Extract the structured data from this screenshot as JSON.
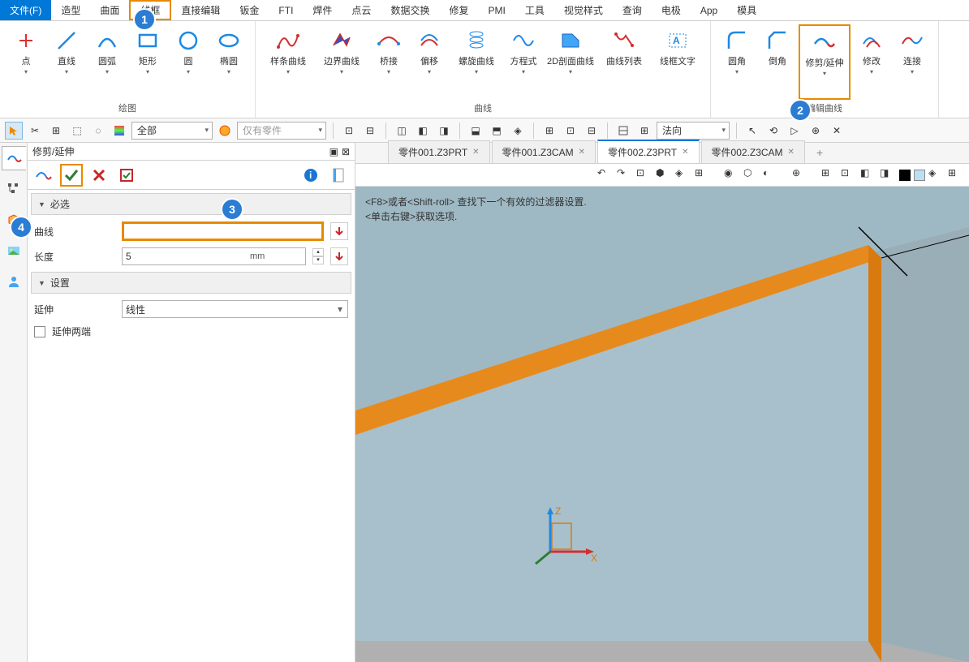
{
  "menu": {
    "file": "文件(F)",
    "items": [
      "造型",
      "曲面",
      "线框",
      "直接编辑",
      "钣金",
      "FTI",
      "焊件",
      "点云",
      "数据交换",
      "修复",
      "PMI",
      "工具",
      "视觉样式",
      "查询",
      "电极",
      "App",
      "模具"
    ],
    "active": 2
  },
  "ribbon": {
    "groups": [
      {
        "name": "绘图",
        "items": [
          {
            "label": "点",
            "color": "#e03030",
            "dd": true
          },
          {
            "label": "直线",
            "color": "#1e88e5",
            "dd": true
          },
          {
            "label": "圆弧",
            "color": "#1e88e5",
            "dd": true
          },
          {
            "label": "矩形",
            "color": "#1e88e5",
            "dd": true
          },
          {
            "label": "圆",
            "color": "#1e88e5",
            "dd": true
          },
          {
            "label": "椭圆",
            "color": "#1e88e5",
            "dd": true
          }
        ]
      },
      {
        "name": "曲线",
        "items": [
          {
            "label": "样条曲线",
            "dd": true
          },
          {
            "label": "边界曲线",
            "dd": true
          },
          {
            "label": "桥接",
            "dd": true
          },
          {
            "label": "偏移",
            "dd": true
          },
          {
            "label": "螺旋曲线",
            "dd": true
          },
          {
            "label": "方程式",
            "dd": true
          },
          {
            "label": "2D剖面曲线",
            "dd": true
          },
          {
            "label": "曲线列表"
          },
          {
            "label": "线框文字"
          }
        ]
      },
      {
        "name": "编辑曲线",
        "items": [
          {
            "label": "圆角",
            "dd": true
          },
          {
            "label": "倒角"
          },
          {
            "label": "修剪/延伸",
            "dd": true,
            "hl": true
          },
          {
            "label": "修改",
            "dd": true
          },
          {
            "label": "连接",
            "dd": true
          }
        ]
      }
    ]
  },
  "qat": {
    "filter1": "全部",
    "filter2": "仅有零件",
    "filter3": "法向"
  },
  "panel": {
    "title": "修剪/延伸",
    "sec1": "必选",
    "curve_lbl": "曲线",
    "length_lbl": "长度",
    "length_val": "5",
    "length_unit": "mm",
    "sec2": "设置",
    "extend_lbl": "延伸",
    "extend_val": "线性",
    "both_lbl": "延伸两端"
  },
  "tabs": [
    {
      "label": "零件001.Z3PRT",
      "active": false
    },
    {
      "label": "零件001.Z3CAM",
      "active": false
    },
    {
      "label": "零件002.Z3PRT",
      "active": true
    },
    {
      "label": "零件002.Z3CAM",
      "active": false
    }
  ],
  "hint": {
    "l1": "<F8>或者<Shift-roll> 查找下一个有效的过滤器设置.",
    "l2": "<单击右键>获取选项."
  },
  "axes": {
    "z": "Z",
    "x": "X"
  },
  "badges": [
    "1",
    "2",
    "3",
    "4"
  ]
}
